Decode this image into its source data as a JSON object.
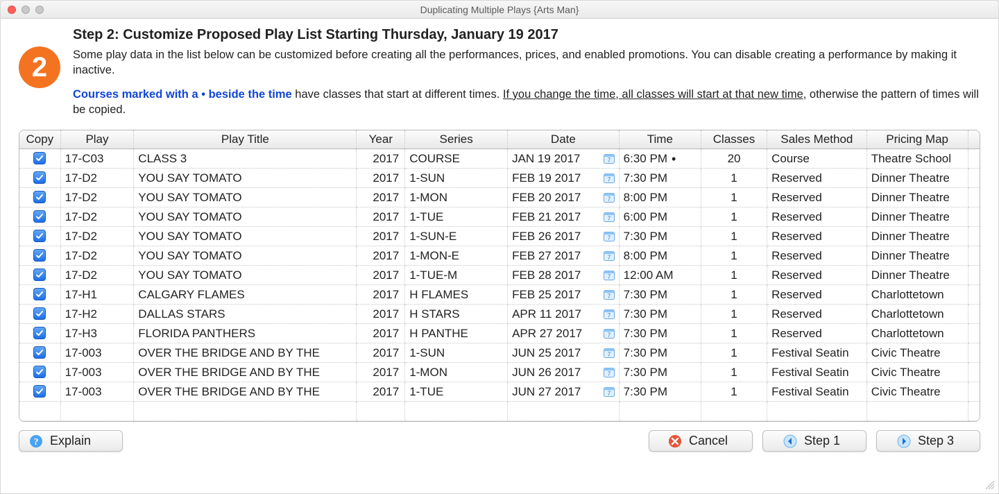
{
  "window": {
    "title": "Duplicating Multiple Plays {Arts Man}"
  },
  "step": {
    "badge": "2",
    "title": "Step 2: Customize Proposed Play List Starting Thursday, January 19 2017",
    "intro": "Some play data in the list below can be customized before creating all the performances, prices, and enabled promotions.  You can disable creating a performance by making it inactive.",
    "note_blue": "Courses marked with a • beside the time",
    "note_mid": " have classes that start at different times.  ",
    "note_underline": "If you change the time, all classes will start at that new time",
    "note_tail": ", otherwise the pattern of times will be copied."
  },
  "columns": {
    "copy": "Copy",
    "play": "Play",
    "title": "Play Title",
    "year": "Year",
    "series": "Series",
    "date": "Date",
    "time": "Time",
    "classes": "Classes",
    "method": "Sales Method",
    "map": "Pricing Map"
  },
  "rows": [
    {
      "copy": true,
      "play": "17-C03",
      "title": "CLASS 3",
      "year": "2017",
      "series": "COURSE",
      "date": "JAN 19 2017",
      "time": "6:30 PM",
      "dot": true,
      "classes": "20",
      "method": "Course",
      "map": "Theatre School"
    },
    {
      "copy": true,
      "play": "17-D2",
      "title": "YOU SAY TOMATO",
      "year": "2017",
      "series": "1-SUN",
      "date": "FEB 19 2017",
      "time": "7:30 PM",
      "dot": false,
      "classes": "1",
      "method": "Reserved",
      "map": "Dinner Theatre"
    },
    {
      "copy": true,
      "play": "17-D2",
      "title": "YOU SAY TOMATO",
      "year": "2017",
      "series": "1-MON",
      "date": "FEB 20 2017",
      "time": "8:00 PM",
      "dot": false,
      "classes": "1",
      "method": "Reserved",
      "map": "Dinner Theatre"
    },
    {
      "copy": true,
      "play": "17-D2",
      "title": "YOU SAY TOMATO",
      "year": "2017",
      "series": "1-TUE",
      "date": "FEB 21 2017",
      "time": "6:00 PM",
      "dot": false,
      "classes": "1",
      "method": "Reserved",
      "map": "Dinner Theatre"
    },
    {
      "copy": true,
      "play": "17-D2",
      "title": "YOU SAY TOMATO",
      "year": "2017",
      "series": "1-SUN-E",
      "date": "FEB 26 2017",
      "time": "7:30 PM",
      "dot": false,
      "classes": "1",
      "method": "Reserved",
      "map": "Dinner Theatre"
    },
    {
      "copy": true,
      "play": "17-D2",
      "title": "YOU SAY TOMATO",
      "year": "2017",
      "series": "1-MON-E",
      "date": "FEB 27 2017",
      "time": "8:00 PM",
      "dot": false,
      "classes": "1",
      "method": "Reserved",
      "map": "Dinner Theatre"
    },
    {
      "copy": true,
      "play": "17-D2",
      "title": "YOU SAY TOMATO",
      "year": "2017",
      "series": "1-TUE-M",
      "date": "FEB 28 2017",
      "time": "12:00 AM",
      "dot": false,
      "classes": "1",
      "method": "Reserved",
      "map": "Dinner Theatre"
    },
    {
      "copy": true,
      "play": "17-H1",
      "title": "CALGARY FLAMES",
      "year": "2017",
      "series": "H FLAMES",
      "date": "FEB 25 2017",
      "time": "7:30 PM",
      "dot": false,
      "classes": "1",
      "method": "Reserved",
      "map": "Charlottetown"
    },
    {
      "copy": true,
      "play": "17-H2",
      "title": "DALLAS STARS",
      "year": "2017",
      "series": "H STARS",
      "date": "APR 11 2017",
      "time": "7:30 PM",
      "dot": false,
      "classes": "1",
      "method": "Reserved",
      "map": "Charlottetown"
    },
    {
      "copy": true,
      "play": "17-H3",
      "title": "FLORIDA PANTHERS",
      "year": "2017",
      "series": "H PANTHE",
      "date": "APR 27 2017",
      "time": "7:30 PM",
      "dot": false,
      "classes": "1",
      "method": "Reserved",
      "map": "Charlottetown"
    },
    {
      "copy": true,
      "play": "17-003",
      "title": "OVER THE BRIDGE AND BY THE",
      "year": "2017",
      "series": "1-SUN",
      "date": "JUN 25 2017",
      "time": "7:30 PM",
      "dot": false,
      "classes": "1",
      "method": "Festival Seatin",
      "map": "Civic Theatre"
    },
    {
      "copy": true,
      "play": "17-003",
      "title": "OVER THE BRIDGE AND BY THE",
      "year": "2017",
      "series": "1-MON",
      "date": "JUN 26 2017",
      "time": "7:30 PM",
      "dot": false,
      "classes": "1",
      "method": "Festival Seatin",
      "map": "Civic Theatre"
    },
    {
      "copy": true,
      "play": "17-003",
      "title": "OVER THE BRIDGE AND BY THE",
      "year": "2017",
      "series": "1-TUE",
      "date": "JUN 27 2017",
      "time": "7:30 PM",
      "dot": false,
      "classes": "1",
      "method": "Festival Seatin",
      "map": "Civic Theatre"
    }
  ],
  "buttons": {
    "explain": "Explain",
    "cancel": "Cancel",
    "prev": "Step 1",
    "next": "Step 3"
  }
}
